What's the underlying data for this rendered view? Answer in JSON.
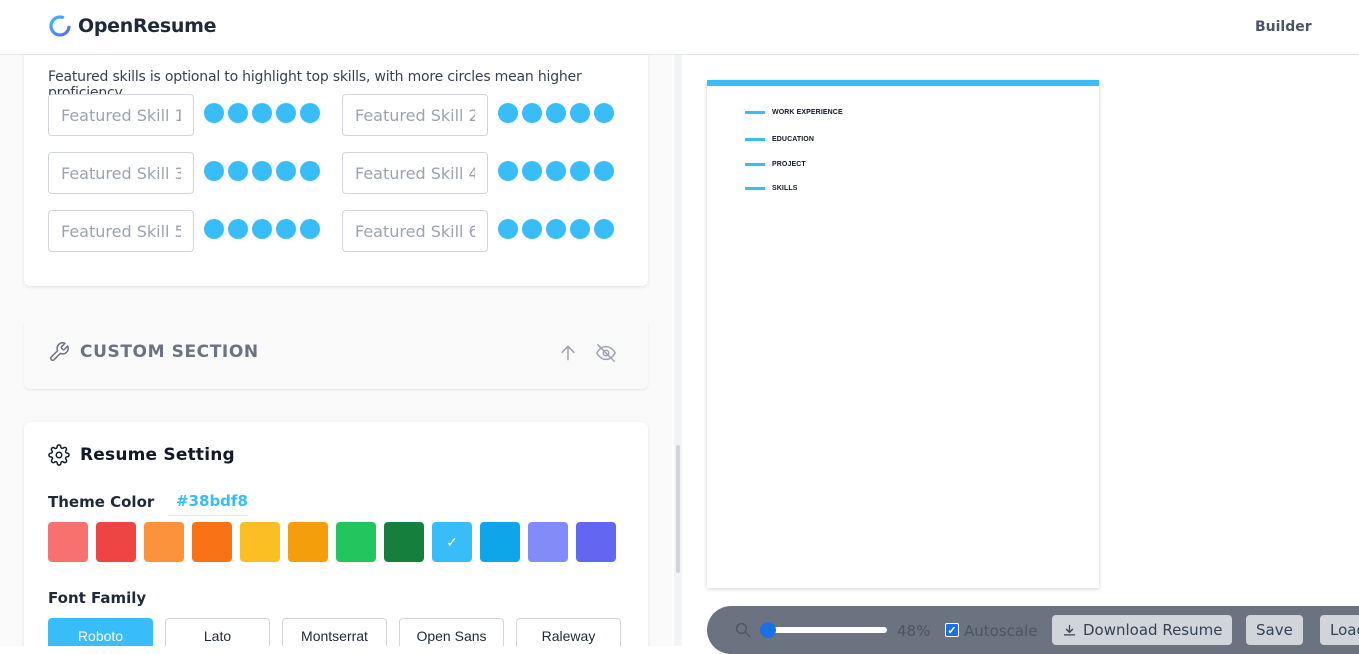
{
  "nav": {
    "brand": "OpenResume",
    "link": "Builder"
  },
  "skills": {
    "helper": "Featured skills is optional to highlight top skills, with more circles mean higher proficiency.",
    "items": [
      {
        "placeholder": "Featured Skill 1",
        "rating": 5
      },
      {
        "placeholder": "Featured Skill 2",
        "rating": 5
      },
      {
        "placeholder": "Featured Skill 3",
        "rating": 5
      },
      {
        "placeholder": "Featured Skill 4",
        "rating": 5
      },
      {
        "placeholder": "Featured Skill 5",
        "rating": 5
      },
      {
        "placeholder": "Featured Skill 6",
        "rating": 5
      }
    ]
  },
  "custom": {
    "title": "CUSTOM SECTION",
    "icon": "wrench-icon"
  },
  "settings": {
    "title": "Resume Setting",
    "theme_label": "Theme Color",
    "theme_value": "#38bdf8",
    "colors": [
      "#f87171",
      "#ef4444",
      "#fb923c",
      "#f97316",
      "#fbbf24",
      "#f59e0b",
      "#22c55e",
      "#15803d",
      "#38bdf8",
      "#0ea5e9",
      "#818cf8",
      "#6366f1"
    ],
    "selected_color_index": 8,
    "check_mark": "✓",
    "font_label": "Font Family",
    "fonts": [
      "Roboto",
      "Lato",
      "Montserrat",
      "Open Sans",
      "Raleway"
    ],
    "selected_font_index": 0
  },
  "preview": {
    "sections": [
      "WORK EXPERIENCE",
      "EDUCATION",
      "PROJECT",
      "SKILLS"
    ]
  },
  "toolbar": {
    "zoom": "48%",
    "autoscale_label": "Autoscale",
    "autoscale_checked": true,
    "download_label": "Download Resume",
    "save_label": "Save",
    "load_label": "Load"
  }
}
